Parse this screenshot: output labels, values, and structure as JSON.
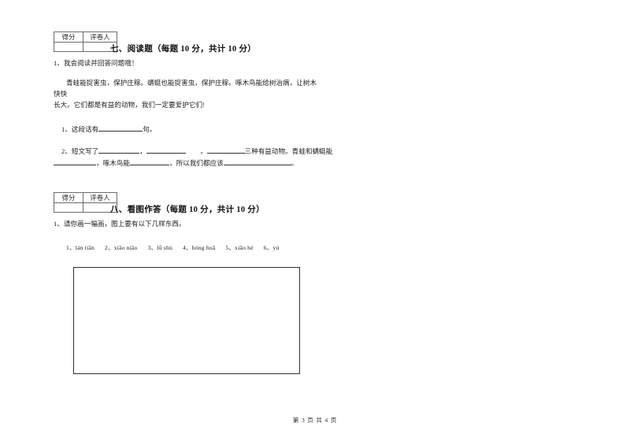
{
  "document": {
    "footer": "第 3 页  共 4 页"
  },
  "score_box": {
    "score_label": "得分",
    "grader_label": "评卷人",
    "score_value": "",
    "grader_value": ""
  },
  "sections": [
    {
      "title": "七、阅读题（每题 10 分，共计 10 分）",
      "prompt": "1、我会阅读并回答问题哦！",
      "passage_line1": "青蛙能捉害虫，保护庄稼。蜻蜓也能捉害虫，保护庄稼。啄木鸟能给树治病，让树木快快",
      "passage_line2": "长大。它们都是有益的动物，我们一定要爱护它们!",
      "questions": [
        {
          "prefix": "1、这段话有",
          "suffix": "句。"
        },
        {
          "line1_prefix": "2、短文写了",
          "line1_mid1": "，",
          "line1_mid2": "，",
          "line1_suffix": "三种有益动物。青蛙和蜻蜓能",
          "line2_mid1": "，啄木鸟能",
          "line2_mid2": "，所以我们都应该",
          "line2_suffix": "。"
        }
      ]
    },
    {
      "title": "八、看图作答（每题 10 分，共计 10 分）",
      "prompt": "1、请你画一幅画，图上要有以下几样东西。",
      "pinyin_items": [
        "1、lán tiān",
        "2、xiǎo niǎo",
        "3、lǜ shù",
        "4、hóng huā",
        "5、xiǎo hé",
        "6、yú"
      ]
    }
  ]
}
